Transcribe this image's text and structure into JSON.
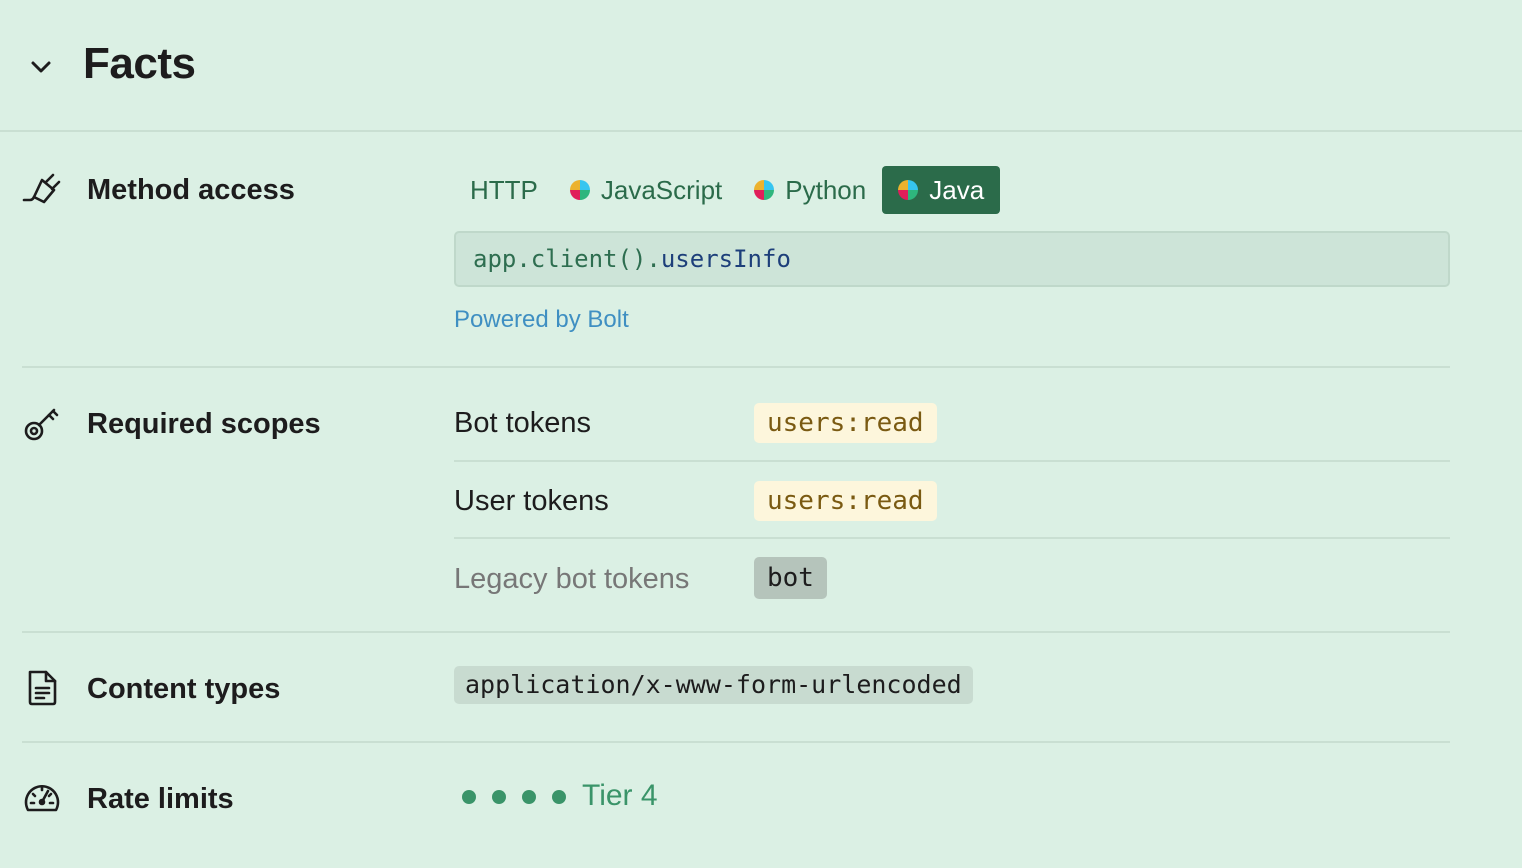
{
  "header": {
    "title": "Facts"
  },
  "method_access": {
    "label": "Method access",
    "tabs": [
      {
        "label": "HTTP",
        "logo": false,
        "active": false
      },
      {
        "label": "JavaScript",
        "logo": true,
        "active": false
      },
      {
        "label": "Python",
        "logo": true,
        "active": false
      },
      {
        "label": "Java",
        "logo": true,
        "active": true
      }
    ],
    "code_prefix": "app.client().",
    "code_method": "usersInfo",
    "powered_by": "Powered by Bolt"
  },
  "required_scopes": {
    "label": "Required scopes",
    "rows": [
      {
        "label": "Bot tokens",
        "scope": "users:read"
      },
      {
        "label": "User tokens",
        "scope": "users:read"
      },
      {
        "label": "Legacy bot tokens",
        "scope": "bot"
      }
    ]
  },
  "content_types": {
    "label": "Content types",
    "value": "application/x-www-form-urlencoded"
  },
  "rate_limits": {
    "label": "Rate limits",
    "tier": "Tier 4",
    "level": 4
  },
  "icons": {
    "collapse": "chevron-down-icon",
    "method": "plug-icon",
    "scopes": "key-icon",
    "content": "document-icon",
    "rate": "speedometer-icon"
  },
  "colors": {
    "background": "#dbf0e4",
    "accent": "#2b6b4a",
    "link": "#3f8fc2",
    "scope_bg": "#fdf6dc",
    "tier": "#3a9469"
  }
}
